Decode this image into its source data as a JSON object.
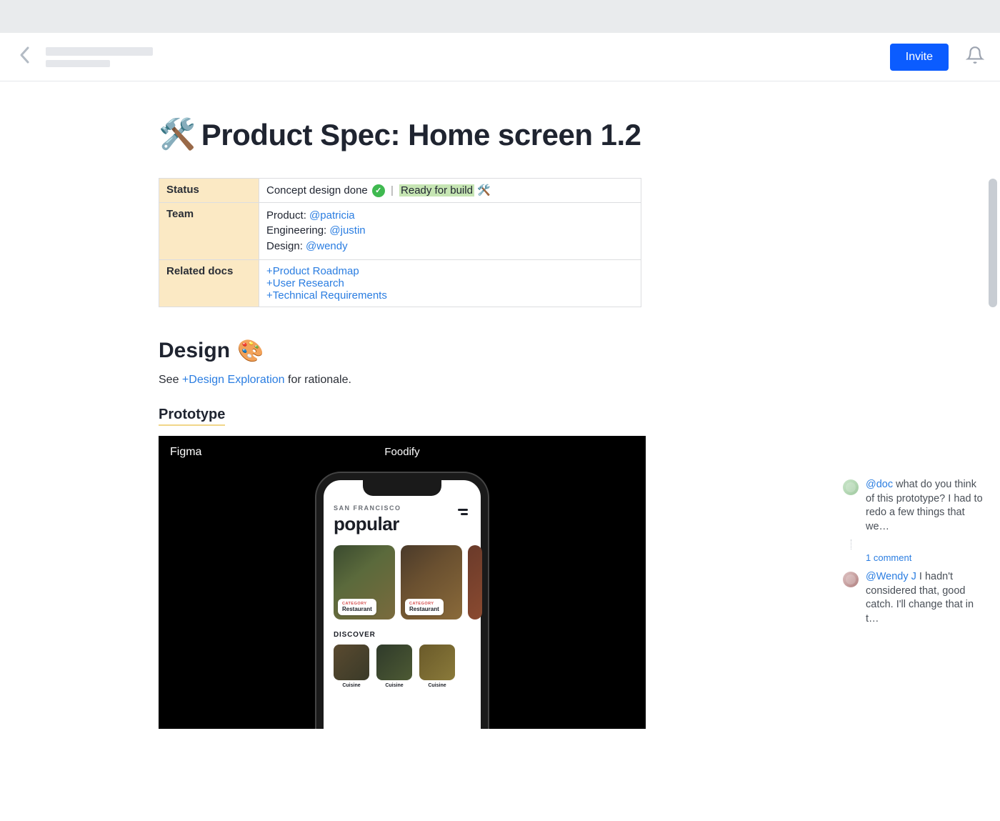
{
  "header": {
    "invite_label": "Invite"
  },
  "page": {
    "title_emoji": "🛠️",
    "title": "Product Spec: Home screen 1.2"
  },
  "info_table": {
    "rows": {
      "status": {
        "label": "Status",
        "text1": "Concept design done",
        "sep": "|",
        "ready_text": "Ready for build",
        "tools_emoji": "🛠️"
      },
      "team": {
        "label": "Team",
        "product_label": "Product: ",
        "product_mention": "@patricia",
        "eng_label": "Engineering: ",
        "eng_mention": "@justin",
        "design_label": "Design: ",
        "design_mention": "@wendy"
      },
      "related": {
        "label": "Related docs",
        "links": [
          "Product Roadmap",
          "User Research",
          "Technical Requirements"
        ]
      }
    }
  },
  "design": {
    "heading": "Design",
    "emoji": "🎨",
    "see_prefix": "See ",
    "see_link": "Design Exploration",
    "see_suffix": " for rationale.",
    "prototype_heading": "Prototype"
  },
  "embed": {
    "tool": "Figma",
    "project": "Foodify",
    "phone": {
      "location_label": "SAN FRANCISCO",
      "main_heading": "popular",
      "card_category": "CATEGORY",
      "card_name": "Restaurant",
      "discover_heading": "DISCOVER",
      "discover_label": "Cuisine"
    }
  },
  "comments": [
    {
      "mention": "@doc",
      "text": " what do you think of this prototype? I had to redo a few things that we…",
      "reply_count_label": "1 comment"
    },
    {
      "mention": "@Wendy J",
      "text": " I hadn't considered that, good catch. I'll change that in t…"
    }
  ]
}
